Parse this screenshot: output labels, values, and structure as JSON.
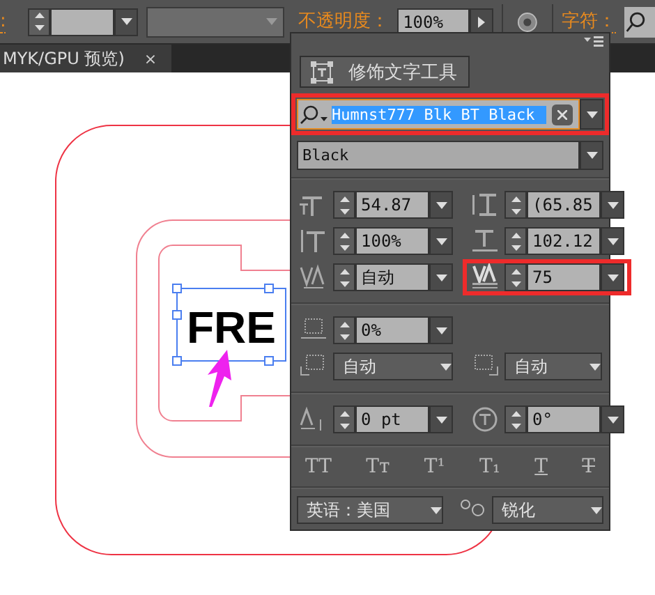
{
  "toolbar": {
    "stroke_label": ":",
    "opacity_label": "不透明度：",
    "opacity_value": "100%",
    "character_label": "字符："
  },
  "document_tab": {
    "title": "MYK/GPU 预览)",
    "close": "×"
  },
  "canvas": {
    "text": "FRE"
  },
  "panel": {
    "trim_button": "修饰文字工具",
    "font_family": {
      "value": "Humnst777 Blk BT Black",
      "highlighted": true
    },
    "font_style": "Black",
    "fields": [
      {
        "kind": "spin",
        "value": "54.87",
        "highlighted": false
      },
      {
        "kind": "spin",
        "value": "(65.85",
        "highlighted": false
      },
      {
        "kind": "spin",
        "value": "100%",
        "highlighted": false
      },
      {
        "kind": "spin",
        "value": "102.12",
        "highlighted": false
      },
      {
        "kind": "spin",
        "value": "自动",
        "highlighted": false
      },
      {
        "kind": "spin",
        "value": "75",
        "highlighted": true
      },
      {
        "kind": "spin",
        "value": "0%",
        "highlighted": false
      },
      {
        "kind": "select",
        "value": "自动",
        "highlighted": false
      },
      {
        "kind": "select",
        "value": "自动",
        "highlighted": false
      },
      {
        "kind": "spin",
        "value": "0 pt",
        "highlighted": false
      },
      {
        "kind": "spin",
        "value": "0°",
        "highlighted": false
      }
    ],
    "style_buttons": [
      {
        "label": "TT",
        "kind": "plain"
      },
      {
        "label": "Tᴛ",
        "kind": "plain"
      },
      {
        "label": "T¹",
        "kind": "plain"
      },
      {
        "label": "T₁",
        "kind": "plain"
      },
      {
        "label": "T",
        "kind": "underline"
      },
      {
        "label": "T",
        "kind": "strike"
      }
    ],
    "language": "英语：美国",
    "antialias": "锐化"
  }
}
